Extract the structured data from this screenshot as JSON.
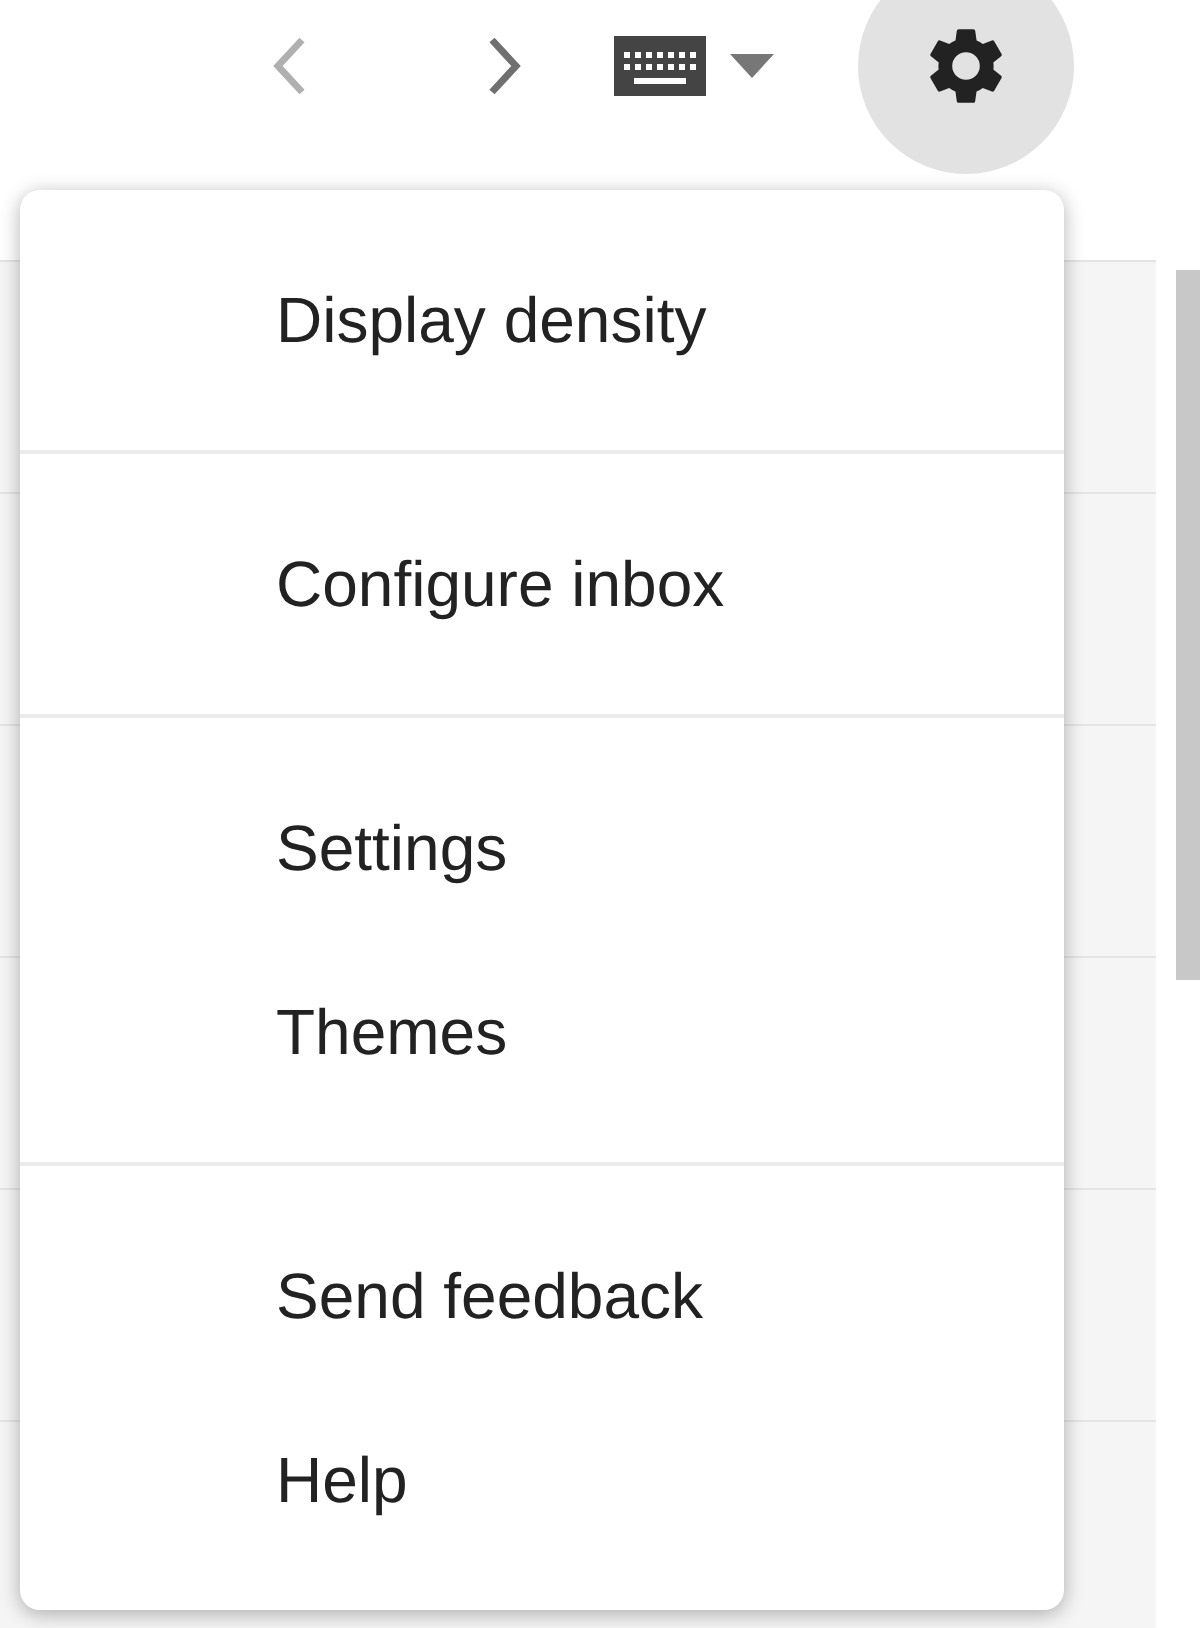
{
  "toolbar": {
    "back_button": {
      "disabled": true
    },
    "forward_button": {
      "disabled": false
    },
    "settings_button": {
      "active": true
    }
  },
  "menu": {
    "groups": [
      {
        "items": [
          "Display density"
        ]
      },
      {
        "items": [
          "Configure inbox"
        ]
      },
      {
        "items": [
          "Settings",
          "Themes"
        ]
      },
      {
        "items": [
          "Send feedback",
          "Help"
        ]
      }
    ]
  }
}
